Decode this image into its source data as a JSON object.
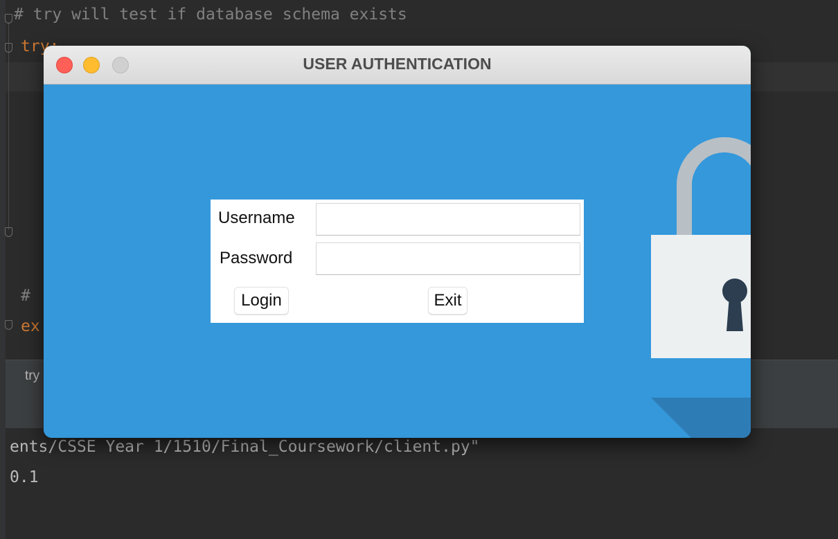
{
  "ide": {
    "code_lines": [
      {
        "text": "# try will test if database schema exists",
        "kind": "comment"
      },
      {
        "text": "try:",
        "kind": "keyword"
      },
      {
        "text": "#",
        "kind": "comment"
      },
      {
        "text": "ex",
        "kind": "keyword"
      }
    ],
    "run_tab_label": "try",
    "console_lines": [
      "ents/CSSE Year 1/1510/Final_Coursework/client.py\"",
      "0.1"
    ]
  },
  "dialog": {
    "title": "USER AUTHENTICATION",
    "username_label": "Username",
    "username_value": "",
    "password_label": "Password",
    "password_value": "",
    "login_label": "Login",
    "exit_label": "Exit",
    "background_color": "#3498db",
    "lock_icon": "padlock-icon"
  }
}
